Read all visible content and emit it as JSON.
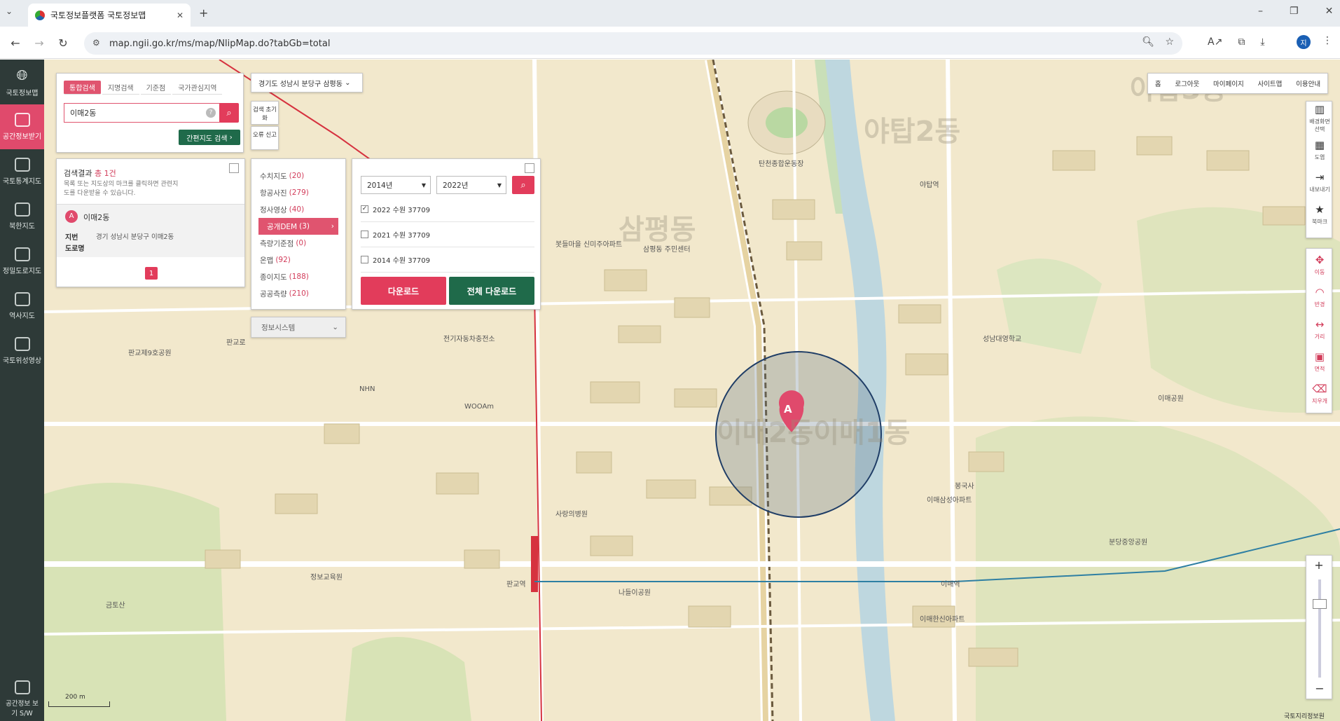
{
  "browser": {
    "tab_title": "국토정보플랫폼 국토정보맵",
    "url": "map.ngii.go.kr/ms/map/NlipMap.do?tabGb=total",
    "profile_initial": "지"
  },
  "sidebar": {
    "items": [
      {
        "label": "국토정보맵",
        "icon": "globe-icon"
      },
      {
        "label": "공간정보받기",
        "icon": "download-map-icon"
      },
      {
        "label": "국토통계지도",
        "icon": "stats-map-icon"
      },
      {
        "label": "북한지도",
        "icon": "nk-map-icon"
      },
      {
        "label": "정밀도로지도",
        "icon": "road-icon"
      },
      {
        "label": "역사지도",
        "icon": "history-icon"
      },
      {
        "label": "국토위성영상",
        "icon": "satellite-icon"
      }
    ],
    "bottom_label": "공간정보 보기 S/W"
  },
  "search": {
    "tabs": [
      "통합검색",
      "지명검색",
      "기준점",
      "국가관심지역"
    ],
    "query": "이매2동",
    "simple_map_btn": "간편지도 검색",
    "reset_btn": "검색 초기화",
    "error_btn": "오류 신고",
    "location": "경기도 성남시 분당구 삼평동"
  },
  "results": {
    "title": "검색결과",
    "total_prefix": "총",
    "total": "1건",
    "desc": "목록 또는 지도상의 마크를 클릭하면 관련지도를 다운받을 수 있습니다.",
    "item": {
      "marker": "A",
      "name": "이매2동",
      "jibun_label": "지번",
      "jibun": "경기 성남시 분당구 이매2동",
      "road_label": "도로명"
    },
    "page": "1"
  },
  "categories": [
    {
      "name": "수치지도",
      "count": "(20)"
    },
    {
      "name": "항공사진",
      "count": "(279)"
    },
    {
      "name": "정사영상",
      "count": "(40)"
    },
    {
      "name": "공개DEM",
      "count": "(3)",
      "active": true
    },
    {
      "name": "측량기준점",
      "count": "(0)"
    },
    {
      "name": "온맵",
      "count": "(92)"
    },
    {
      "name": "종이지도",
      "count": "(188)"
    },
    {
      "name": "공공측량",
      "count": "(210)"
    }
  ],
  "info_system": "정보시스템",
  "dem": {
    "from_year": "2014년",
    "to_year": "2022년",
    "items": [
      {
        "label": "2022 수원 37709",
        "checked": true
      },
      {
        "label": "2021 수원 37709",
        "checked": false
      },
      {
        "label": "2014 수원 37709",
        "checked": false
      }
    ],
    "download": "다운로드",
    "download_all": "전체 다운로드"
  },
  "topnav": [
    "홈",
    "로그아웃",
    "마이페이지",
    "사이트맵",
    "이용안내"
  ],
  "tools": [
    {
      "label": "배경화면 선택",
      "icon": "map-icon"
    },
    {
      "label": "도엽",
      "icon": "grid-icon"
    },
    {
      "label": "내보내기",
      "icon": "export-icon"
    },
    {
      "label": "북마크",
      "icon": "star-icon"
    },
    {
      "label": "이동",
      "icon": "move-icon"
    },
    {
      "label": "반경",
      "icon": "radius-icon"
    },
    {
      "label": "거리",
      "icon": "ruler-icon"
    },
    {
      "label": "면적",
      "icon": "area-icon"
    },
    {
      "label": "지우개",
      "icon": "eraser-icon"
    }
  ],
  "scale": "200 m",
  "copyright": "국토지리정보원",
  "map_labels": {
    "big1": "야탑2동",
    "big2": "삼평동",
    "big3": "이매2동이매1동",
    "big4": "야탑3동",
    "marker": "A",
    "places": [
      "탄천종합운동장",
      "야탑역",
      "판교역",
      "이매역",
      "삼평동 주민센터",
      "판교제9호공원",
      "봇들마을 신미주아파트",
      "전기자동차충전소",
      "WOOAm",
      "NHN",
      "나들이공원",
      "사랑의병원",
      "정보교육원",
      "금토산",
      "이매공원",
      "봉국사",
      "분당중앙공원",
      "성남대영학교",
      "판교로",
      "이매한신아파트",
      "이매삼성아파트"
    ]
  }
}
